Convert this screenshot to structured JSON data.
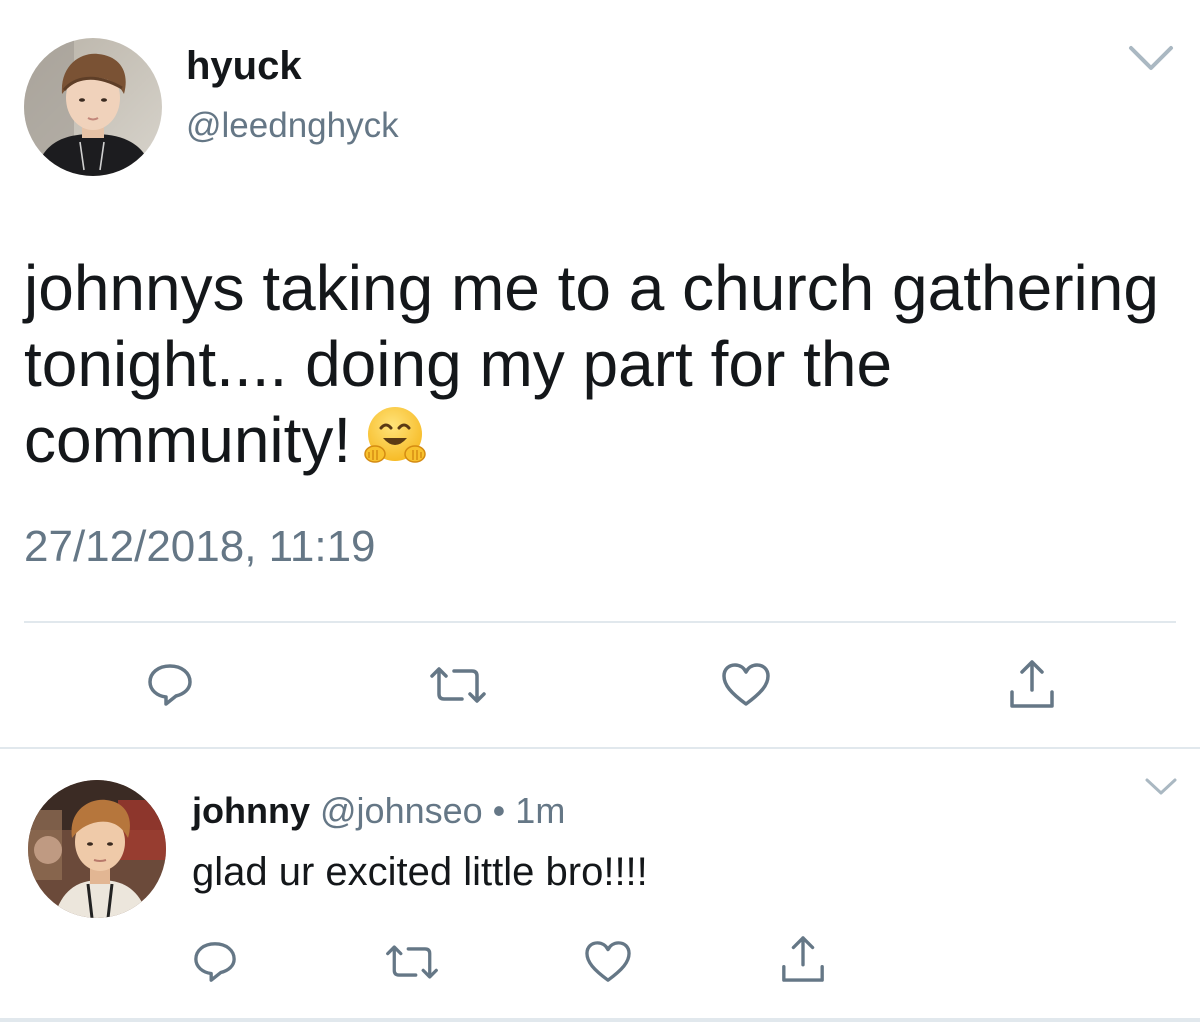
{
  "main_tweet": {
    "display_name": "hyuck",
    "handle": "@leednghyck",
    "text_lines": [
      "johnnys taking me to a church gathering",
      "tonight.... doing my part for the",
      "community!"
    ],
    "emoji": "hugging-face-emoji",
    "timestamp": "27/12/2018, 11:19",
    "actions": [
      "reply-icon",
      "retweet-icon",
      "like-icon",
      "share-icon"
    ]
  },
  "reply_tweet": {
    "display_name": "johnny",
    "handle": "@johnseo",
    "separator": "•",
    "time": "1m",
    "text": "glad ur excited little bro!!!!",
    "actions": [
      "reply-icon",
      "retweet-icon",
      "like-icon",
      "share-icon"
    ]
  },
  "colors": {
    "text": "#14171a",
    "secondary_text": "#657786",
    "icon": "#657786",
    "divider": "#e1e8ed",
    "background": "#ffffff"
  }
}
